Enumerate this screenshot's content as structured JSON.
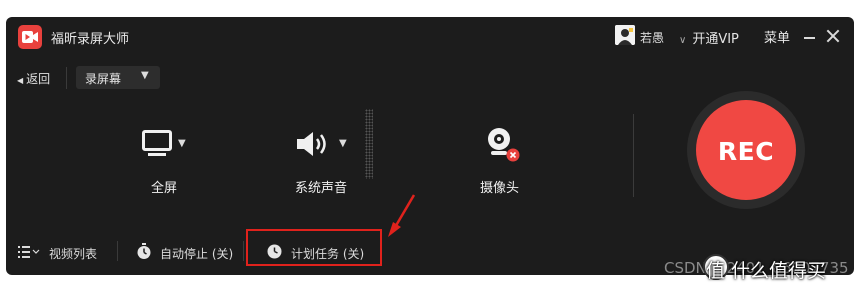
{
  "app": {
    "title": "福昕录屏大师",
    "username": "若愚",
    "vip_label": "开通VIP",
    "menu_label": "菜单",
    "brand_color": "#e8413d"
  },
  "toolbar": {
    "back_label": "返回",
    "mode_selected": "录屏幕"
  },
  "sources": {
    "screen_label": "全屏",
    "sound_label": "系统声音",
    "camera_label": "摄像头"
  },
  "rec": {
    "label": "REC",
    "color": "#f04843"
  },
  "bottom": {
    "video_list_label": "视频列表",
    "auto_stop_label": "自动停止 (关)",
    "schedule_label": "计划任务 (关)"
  },
  "annotation": {
    "highlight_color": "#e0221c"
  },
  "watermark": {
    "csdn": "CSDN @2401_86007735",
    "site": "值 什么值得买"
  },
  "icons": [
    "app-logo-icon",
    "avatar-icon",
    "chevron-down-icon",
    "minimize-icon",
    "close-icon",
    "back-arrow-icon",
    "monitor-icon",
    "speaker-icon",
    "webcam-icon",
    "camera-off-badge-icon",
    "list-icon",
    "timer-icon",
    "clock-icon",
    "arrow-pointer-icon"
  ]
}
